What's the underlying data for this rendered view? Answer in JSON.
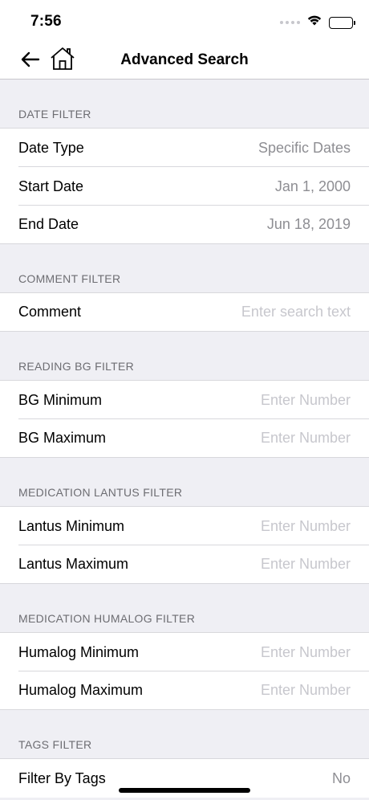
{
  "status_bar": {
    "time": "7:56"
  },
  "nav": {
    "title": "Advanced Search"
  },
  "sections": [
    {
      "header": "DATE FILTER",
      "rows": [
        {
          "label": "Date Type",
          "value": "Specific Dates"
        },
        {
          "label": "Start Date",
          "value": "Jan 1, 2000"
        },
        {
          "label": "End Date",
          "value": "Jun 18, 2019"
        }
      ]
    },
    {
      "header": "COMMENT FILTER",
      "rows": [
        {
          "label": "Comment",
          "placeholder": "Enter search text"
        }
      ]
    },
    {
      "header": "READING BG FILTER",
      "rows": [
        {
          "label": "BG Minimum",
          "placeholder": "Enter Number"
        },
        {
          "label": "BG Maximum",
          "placeholder": "Enter Number"
        }
      ]
    },
    {
      "header": "MEDICATION LANTUS FILTER",
      "rows": [
        {
          "label": "Lantus Minimum",
          "placeholder": "Enter Number"
        },
        {
          "label": "Lantus Maximum",
          "placeholder": "Enter Number"
        }
      ]
    },
    {
      "header": "MEDICATION HUMALOG FILTER",
      "rows": [
        {
          "label": "Humalog Minimum",
          "placeholder": "Enter Number"
        },
        {
          "label": "Humalog Maximum",
          "placeholder": "Enter Number"
        }
      ]
    },
    {
      "header": "TAGS FILTER",
      "rows": [
        {
          "label": "Filter By Tags",
          "value": "No"
        }
      ]
    }
  ]
}
